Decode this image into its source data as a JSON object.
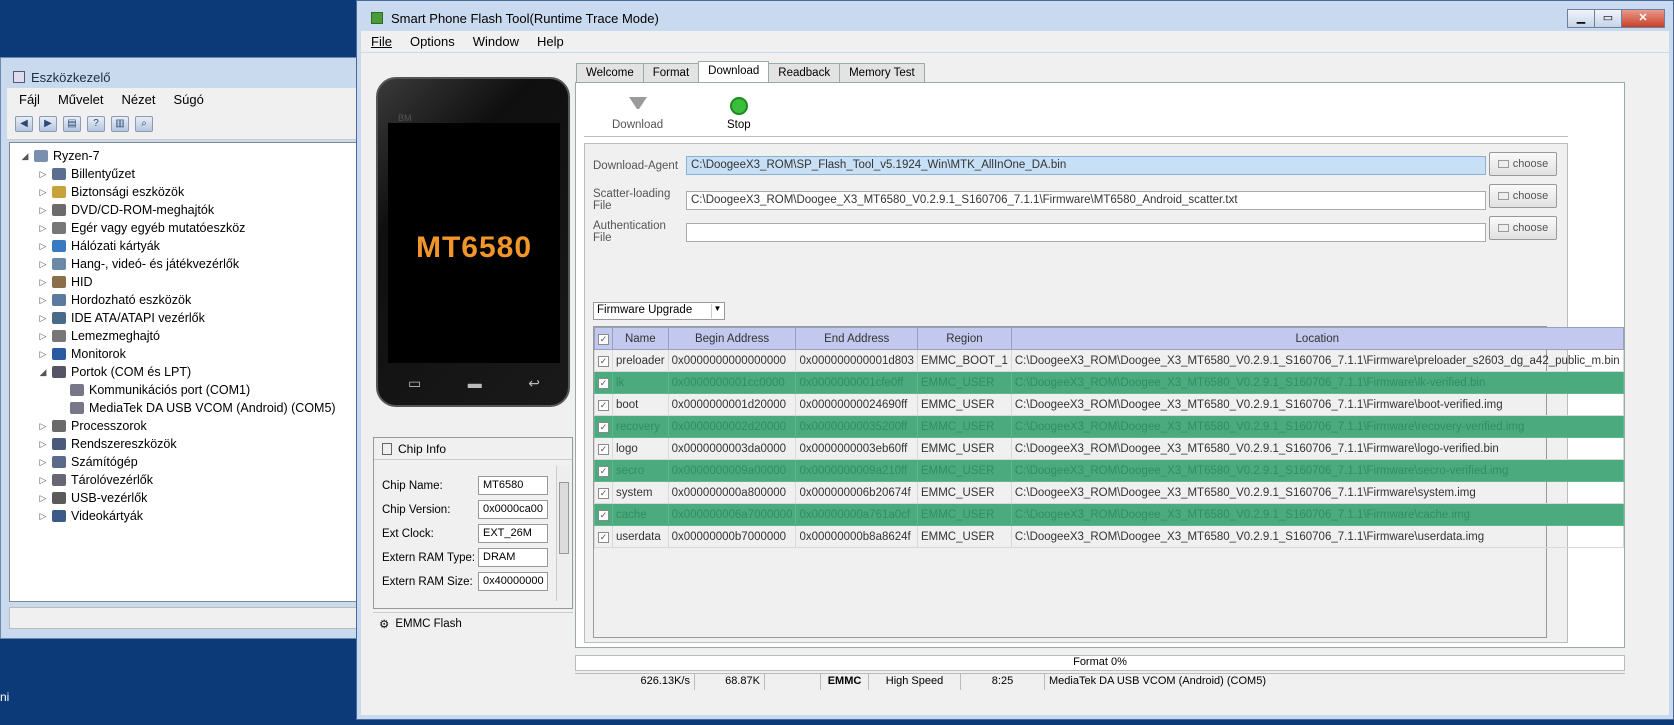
{
  "desktop": {
    "fragment": "ni"
  },
  "device_manager": {
    "title": "Eszközkezelő",
    "menu": [
      "Fájl",
      "Művelet",
      "Nézet",
      "Súgó"
    ],
    "tree": [
      {
        "label": "Ryzen-7",
        "level": 0,
        "expander": "◢"
      },
      {
        "label": "Billentyűzet",
        "level": 1,
        "expander": "▷"
      },
      {
        "label": "Biztonsági eszközök",
        "level": 1,
        "expander": "▷"
      },
      {
        "label": "DVD/CD-ROM-meghajtók",
        "level": 1,
        "expander": "▷"
      },
      {
        "label": "Egér vagy egyéb mutatóeszköz",
        "level": 1,
        "expander": "▷"
      },
      {
        "label": "Hálózati kártyák",
        "level": 1,
        "expander": "▷"
      },
      {
        "label": "Hang-, videó- és játékvezérlők",
        "level": 1,
        "expander": "▷"
      },
      {
        "label": "HID",
        "level": 1,
        "expander": "▷"
      },
      {
        "label": "Hordozható eszközök",
        "level": 1,
        "expander": "▷"
      },
      {
        "label": "IDE ATA/ATAPI vezérlők",
        "level": 1,
        "expander": "▷"
      },
      {
        "label": "Lemezmeghajtó",
        "level": 1,
        "expander": "▷"
      },
      {
        "label": "Monitorok",
        "level": 1,
        "expander": "▷"
      },
      {
        "label": "Portok (COM és LPT)",
        "level": 1,
        "expander": "◢"
      },
      {
        "label": "Kommunikációs port (COM1)",
        "level": 2,
        "expander": ""
      },
      {
        "label": "MediaTek DA USB VCOM (Android) (COM5)",
        "level": 2,
        "expander": ""
      },
      {
        "label": "Processzorok",
        "level": 1,
        "expander": "▷"
      },
      {
        "label": "Rendszereszközök",
        "level": 1,
        "expander": "▷"
      },
      {
        "label": "Számítógép",
        "level": 1,
        "expander": "▷"
      },
      {
        "label": "Tárolóvezérlők",
        "level": 1,
        "expander": "▷"
      },
      {
        "label": "USB-vezérlők",
        "level": 1,
        "expander": "▷"
      },
      {
        "label": "Videokártyák",
        "level": 1,
        "expander": "▷"
      }
    ]
  },
  "flash_tool": {
    "title": "Smart Phone Flash Tool(Runtime Trace Mode)",
    "menu": [
      "File",
      "Options",
      "Window",
      "Help"
    ],
    "phone": {
      "brand": "BM",
      "chip": "MT6580"
    },
    "chip_info": {
      "title": "Chip Info",
      "rows": [
        {
          "label": "Chip Name:",
          "value": "MT6580"
        },
        {
          "label": "Chip Version:",
          "value": "0x0000ca00"
        },
        {
          "label": "Ext Clock:",
          "value": "EXT_26M"
        },
        {
          "label": "Extern RAM Type:",
          "value": "DRAM"
        },
        {
          "label": "Extern RAM Size:",
          "value": "0x40000000"
        }
      ],
      "storage": "EMMC Flash"
    },
    "tabs": [
      "Welcome",
      "Format",
      "Download",
      "Readback",
      "Memory Test"
    ],
    "active_tab": "Download",
    "actions": {
      "download": "Download",
      "stop": "Stop"
    },
    "download_agent": {
      "label": "Download-Agent",
      "value": "C:\\DoogeeX3_ROM\\SP_Flash_Tool_v5.1924_Win\\MTK_AllInOne_DA.bin"
    },
    "scatter": {
      "label": "Scatter-loading File",
      "value": "C:\\DoogeeX3_ROM\\Doogee_X3_MT6580_V0.2.9.1_S160706_7.1.1\\Firmware\\MT6580_Android_scatter.txt"
    },
    "auth": {
      "label": "Authentication File",
      "value": ""
    },
    "choose_label": "choose",
    "mode": "Firmware Upgrade",
    "table": {
      "headers": [
        "Name",
        "Begin Address",
        "End Address",
        "Region",
        "Location"
      ],
      "rows": [
        {
          "name": "preloader",
          "begin": "0x0000000000000000",
          "end": "0x000000000001d803",
          "region": "EMMC_BOOT_1",
          "location": "C:\\DoogeeX3_ROM\\Doogee_X3_MT6580_V0.2.9.1_S160706_7.1.1\\Firmware\\preloader_s2603_dg_a42_public_m.bin",
          "hl": false
        },
        {
          "name": "lk",
          "begin": "0x0000000001cc0000",
          "end": "0x0000000001cfe0ff",
          "region": "EMMC_USER",
          "location": "C:\\DoogeeX3_ROM\\Doogee_X3_MT6580_V0.2.9.1_S160706_7.1.1\\Firmware\\lk-verified.bin",
          "hl": true
        },
        {
          "name": "boot",
          "begin": "0x0000000001d20000",
          "end": "0x00000000024690ff",
          "region": "EMMC_USER",
          "location": "C:\\DoogeeX3_ROM\\Doogee_X3_MT6580_V0.2.9.1_S160706_7.1.1\\Firmware\\boot-verified.img",
          "hl": false
        },
        {
          "name": "recovery",
          "begin": "0x0000000002d20000",
          "end": "0x00000000035200ff",
          "region": "EMMC_USER",
          "location": "C:\\DoogeeX3_ROM\\Doogee_X3_MT6580_V0.2.9.1_S160706_7.1.1\\Firmware\\recovery-verified.img",
          "hl": true
        },
        {
          "name": "logo",
          "begin": "0x0000000003da0000",
          "end": "0x0000000003eb60ff",
          "region": "EMMC_USER",
          "location": "C:\\DoogeeX3_ROM\\Doogee_X3_MT6580_V0.2.9.1_S160706_7.1.1\\Firmware\\logo-verified.bin",
          "hl": false
        },
        {
          "name": "secro",
          "begin": "0x0000000009a00000",
          "end": "0x0000000009a210ff",
          "region": "EMMC_USER",
          "location": "C:\\DoogeeX3_ROM\\Doogee_X3_MT6580_V0.2.9.1_S160706_7.1.1\\Firmware\\secro-verified.img",
          "hl": true
        },
        {
          "name": "system",
          "begin": "0x000000000a800000",
          "end": "0x000000006b20674f",
          "region": "EMMC_USER",
          "location": "C:\\DoogeeX3_ROM\\Doogee_X3_MT6580_V0.2.9.1_S160706_7.1.1\\Firmware\\system.img",
          "hl": false
        },
        {
          "name": "cache",
          "begin": "0x000000006a7000000",
          "end": "0x00000000a761a0cf",
          "region": "EMMC_USER",
          "location": "C:\\DoogeeX3_ROM\\Doogee_X3_MT6580_V0.2.9.1_S160706_7.1.1\\Firmware\\cache.img",
          "hl": true
        },
        {
          "name": "userdata",
          "begin": "0x00000000b7000000",
          "end": "0x00000000b8a8624f",
          "region": "EMMC_USER",
          "location": "C:\\DoogeeX3_ROM\\Doogee_X3_MT6580_V0.2.9.1_S160706_7.1.1\\Firmware\\userdata.img",
          "hl": false
        }
      ]
    },
    "status": {
      "progress": "Format 0%",
      "speed": "626.13K/s",
      "size": "68.87K",
      "blank": "",
      "storage": "EMMC",
      "usb": "High Speed",
      "time": "8:25",
      "port": "MediaTek DA USB VCOM (Android) (COM5)"
    }
  }
}
